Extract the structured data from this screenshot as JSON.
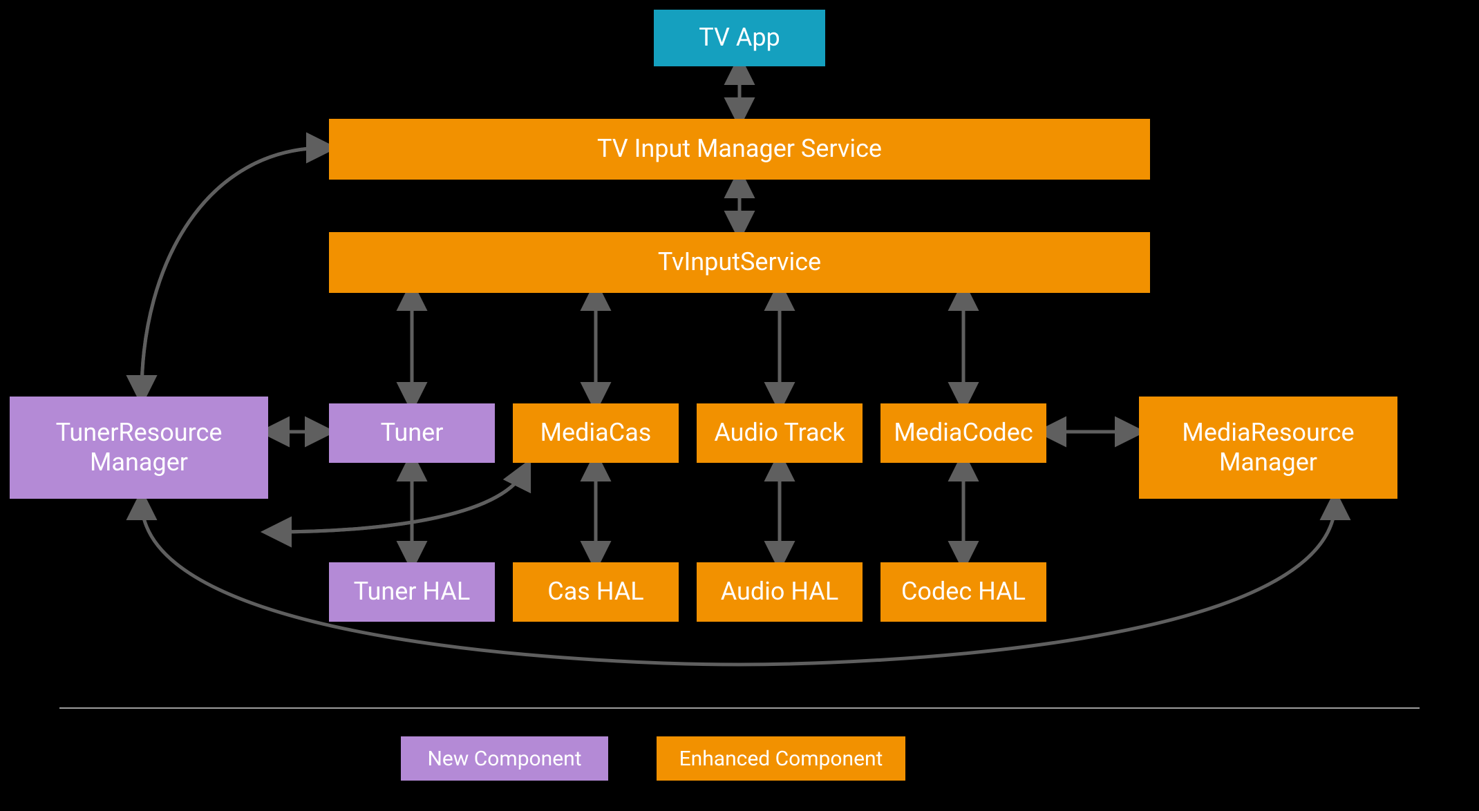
{
  "boxes": {
    "tv_app": "TV App",
    "tim_service": "TV Input Manager Service",
    "tv_input_service": "TvInputService",
    "tuner": "Tuner",
    "media_cas": "MediaCas",
    "audio_track": "Audio Track",
    "media_codec": "MediaCodec",
    "tuner_resource_manager": "TunerResource\nManager",
    "media_resource_manager": "MediaResource\nManager",
    "tuner_hal": "Tuner HAL",
    "cas_hal": "Cas HAL",
    "audio_hal": "Audio HAL",
    "codec_hal": "Codec HAL"
  },
  "legend": {
    "new_component": "New Component",
    "enhanced_component": "Enhanced Component"
  },
  "colors": {
    "blue": "#15a0bf",
    "orange": "#f29100",
    "purple": "#b48ad6",
    "arrow": "#5f5f5f",
    "divider": "#9e9e9e",
    "bg": "#000000",
    "text": "#ffffff"
  }
}
